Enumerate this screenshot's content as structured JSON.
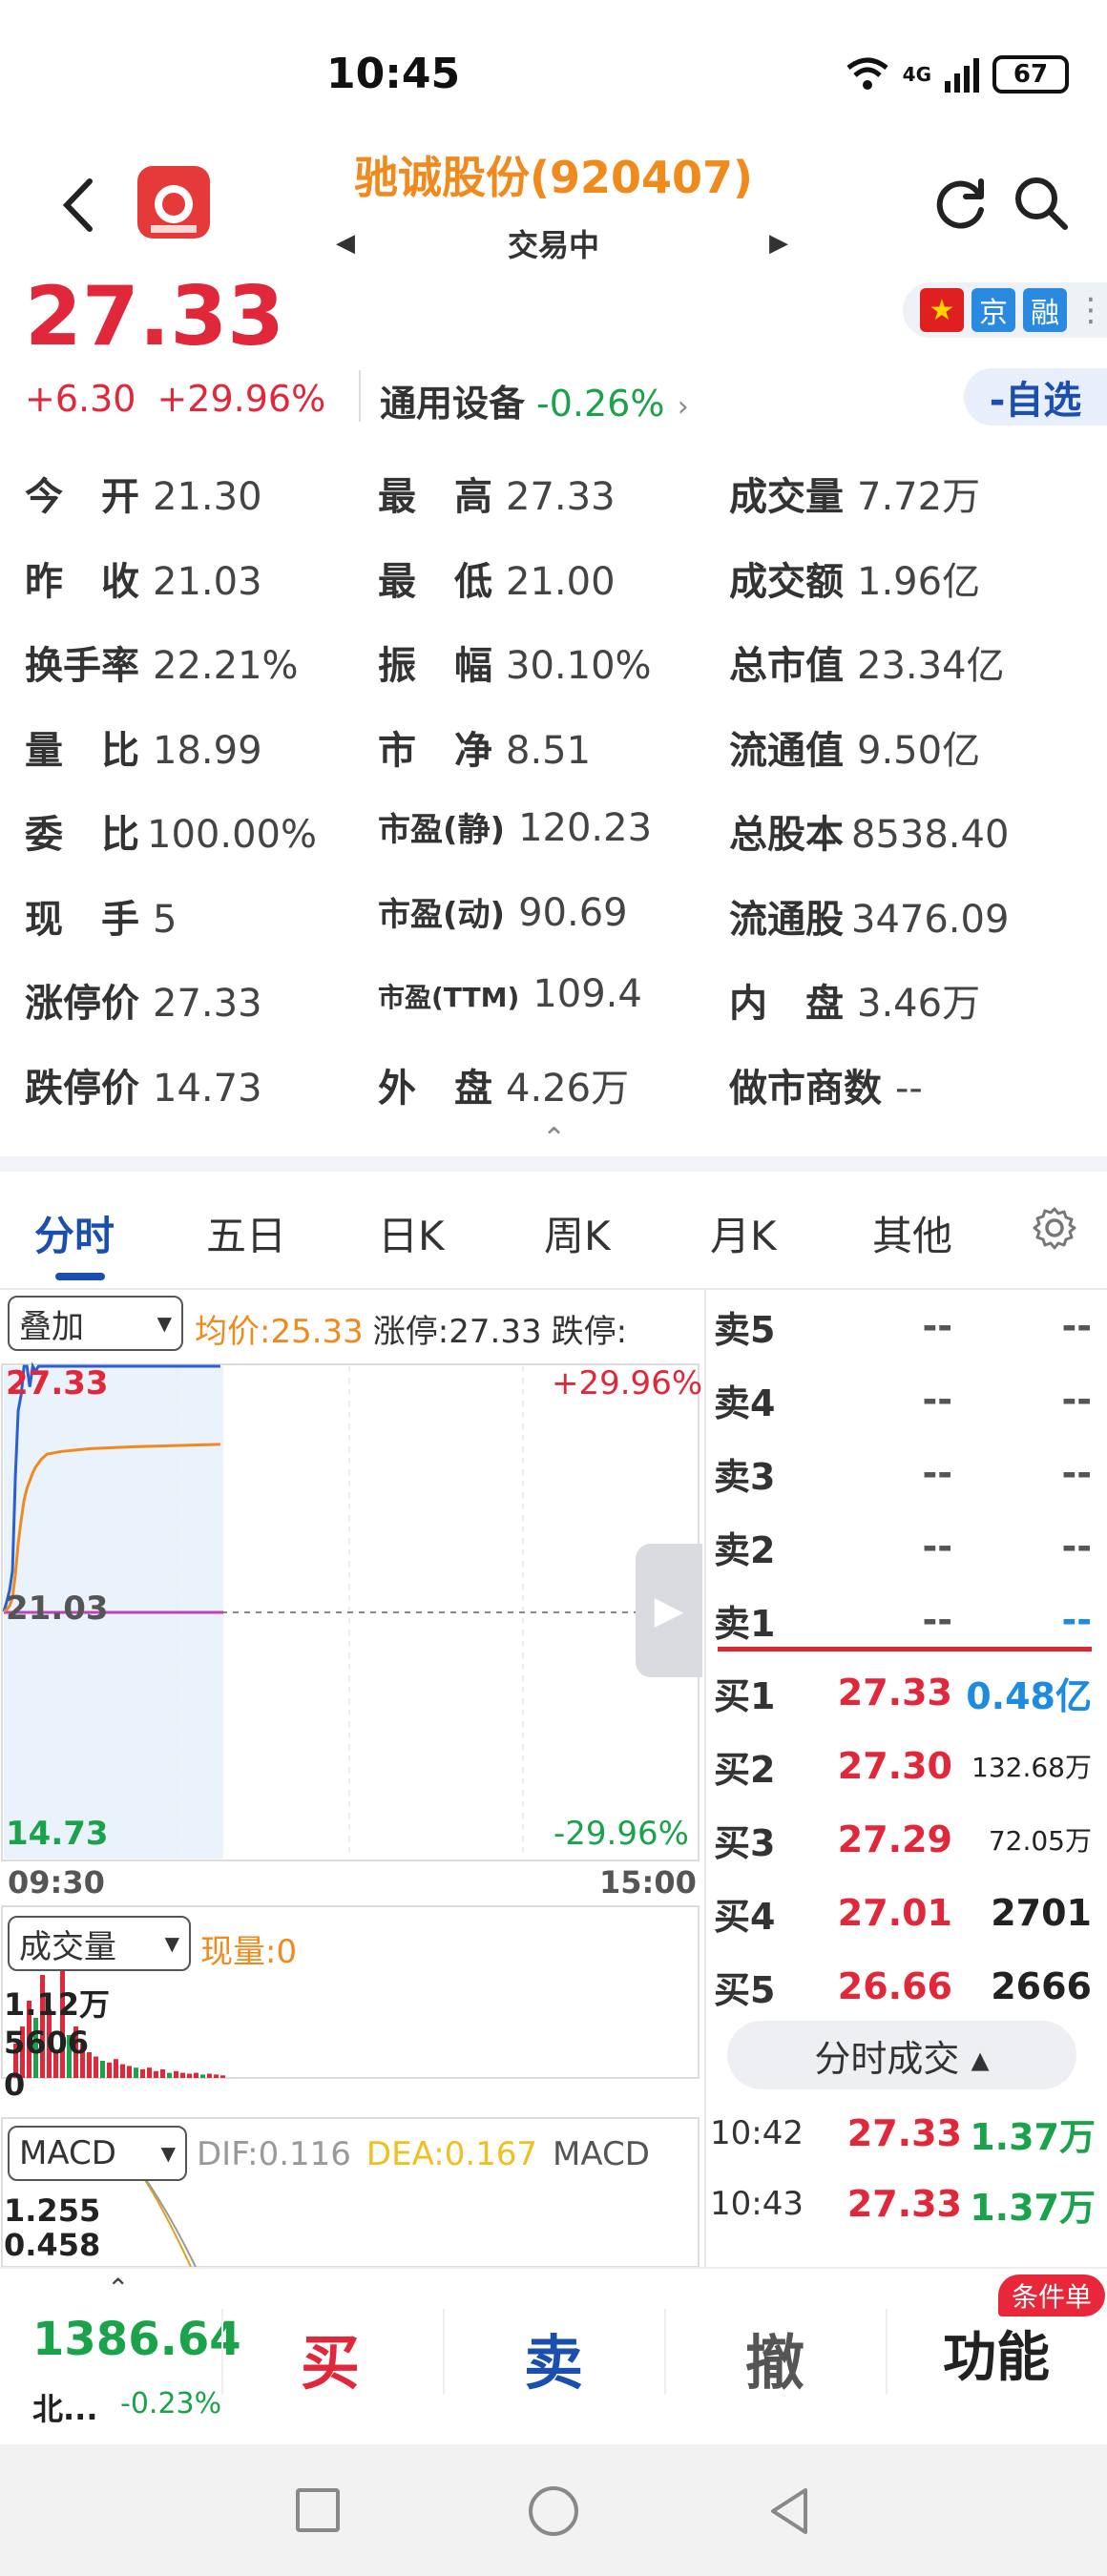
{
  "status_bar": {
    "time": "10:45",
    "network": "4G",
    "battery": "67"
  },
  "header": {
    "title": "驰诚股份(920407)",
    "trade_status": "交易中",
    "prev_symbol": "◀",
    "next_symbol": "▶"
  },
  "quote": {
    "last_price": "27.33",
    "change": "+6.30",
    "change_pct": "+29.96%",
    "sector_name": "通用设备",
    "sector_change": "-0.26%",
    "sector_arrow": "›",
    "tags": [
      "京",
      "融"
    ],
    "watch_label": "-自选"
  },
  "stats": [
    {
      "k": "今　开",
      "v": "21.30"
    },
    {
      "k": "最　高",
      "v": "27.33"
    },
    {
      "k": "成交量",
      "v": "7.72万"
    },
    {
      "k": "昨　收",
      "v": "21.03"
    },
    {
      "k": "最　低",
      "v": "21.00"
    },
    {
      "k": "成交额",
      "v": "1.96亿"
    },
    {
      "k": "换手率",
      "v": "22.21%"
    },
    {
      "k": "振　幅",
      "v": "30.10%"
    },
    {
      "k": "总市值",
      "v": "23.34亿"
    },
    {
      "k": "量　比",
      "v": "18.99"
    },
    {
      "k": "市　净",
      "v": "8.51"
    },
    {
      "k": "流通值",
      "v": "9.50亿"
    },
    {
      "k": "委　比",
      "v": "100.00%"
    },
    {
      "k": "市盈(静)",
      "v": "120.23"
    },
    {
      "k": "总股本",
      "v": "8538.40"
    },
    {
      "k": "现　手",
      "v": "5"
    },
    {
      "k": "市盈(动)",
      "v": "90.69"
    },
    {
      "k": "流通股",
      "v": "3476.09"
    },
    {
      "k": "涨停价",
      "v": "27.33"
    },
    {
      "k": "市盈(TTM)",
      "v": "109.4"
    },
    {
      "k": "内　盘",
      "v": "3.46万"
    },
    {
      "k": "跌停价",
      "v": "14.73"
    },
    {
      "k": "外　盘",
      "v": "4.26万"
    },
    {
      "k": "做市商数",
      "v": "--"
    }
  ],
  "tabs": [
    "分时",
    "五日",
    "日K",
    "周K",
    "月K",
    "其他"
  ],
  "chart": {
    "overlay_select": "叠加",
    "legend_avg": "均价:25.33",
    "legend_limit_up": "涨停:27.33",
    "legend_limit_down": "跌停:",
    "price_top": "27.33",
    "pct_top": "+29.96%",
    "price_mid": "21.03",
    "price_bot": "14.73",
    "pct_bot": "-29.96%",
    "time_start": "09:30",
    "time_end": "15:00",
    "vol_select": "成交量",
    "vol_legend": "现量:0",
    "vol_max": "1.12万",
    "vol_mid": "5606",
    "vol_zero": "0",
    "macd_select": "MACD",
    "macd_dif": "DIF:0.116",
    "macd_dea": "DEA:0.167",
    "macd_macd": "MACD",
    "macd_v1": "1.255",
    "macd_v2": "0.458"
  },
  "chart_data": {
    "type": "line",
    "x": [
      "09:30",
      "09:31",
      "09:32",
      "09:33",
      "09:34",
      "09:35",
      "09:36",
      "09:37",
      "09:38",
      "09:39",
      "09:40",
      "09:41",
      "09:42",
      "09:43",
      "09:44",
      "09:45",
      "09:50",
      "10:00",
      "10:15",
      "10:30",
      "10:45"
    ],
    "series": [
      {
        "name": "price",
        "values": [
          21.05,
          21.3,
          21.6,
          22.1,
          24.5,
          26.2,
          26.6,
          27.33,
          27.33,
          26.8,
          27.33,
          27.2,
          27.33,
          27.33,
          27.33,
          27.33,
          27.33,
          27.33,
          27.33,
          27.33,
          27.33
        ]
      },
      {
        "name": "均价",
        "values": [
          21.05,
          21.1,
          21.2,
          21.4,
          22.0,
          22.8,
          23.4,
          23.9,
          24.2,
          24.4,
          24.6,
          24.75,
          24.85,
          24.95,
          25.02,
          25.08,
          25.15,
          25.22,
          25.27,
          25.3,
          25.33
        ]
      }
    ],
    "ylim": [
      14.73,
      27.33
    ],
    "ref_close": 21.03,
    "xlim": [
      "09:30",
      "15:00"
    ]
  },
  "order_book": {
    "asks": [
      {
        "label": "卖5",
        "price": "--",
        "volume": "--"
      },
      {
        "label": "卖4",
        "price": "--",
        "volume": "--"
      },
      {
        "label": "卖3",
        "price": "--",
        "volume": "--"
      },
      {
        "label": "卖2",
        "price": "--",
        "volume": "--"
      },
      {
        "label": "卖1",
        "price": "--",
        "volume": "--"
      }
    ],
    "bids": [
      {
        "label": "买1",
        "price": "27.33",
        "volume": "0.48亿"
      },
      {
        "label": "买2",
        "price": "27.30",
        "volume": "132.68万"
      },
      {
        "label": "买3",
        "price": "27.29",
        "volume": "72.05万"
      },
      {
        "label": "买4",
        "price": "27.01",
        "volume": "2701"
      },
      {
        "label": "买5",
        "price": "26.66",
        "volume": "2666"
      }
    ],
    "trades_toggle": "分时成交 ▴",
    "trades": [
      {
        "time": "10:42",
        "price": "27.33",
        "volume": "1.37万"
      },
      {
        "time": "10:43",
        "price": "27.33",
        "volume": "1.37万"
      }
    ]
  },
  "bottom_bar": {
    "index_value": "1386.64",
    "index_name": "北...",
    "index_change": "-0.23%",
    "buy": "买",
    "sell": "卖",
    "cancel": "撤",
    "func": "功能",
    "badge": "条件单"
  }
}
